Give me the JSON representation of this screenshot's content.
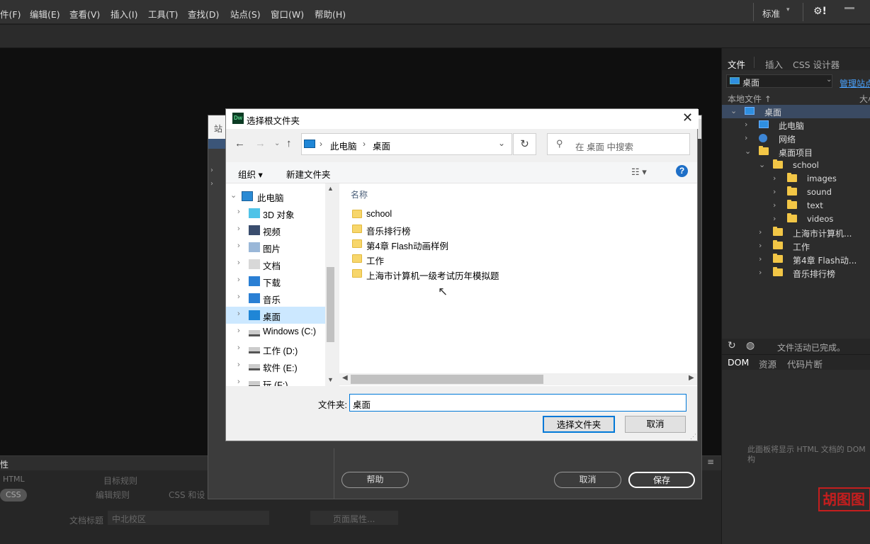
{
  "menubar": {
    "items": [
      "件(F)",
      "编辑(E)",
      "查看(V)",
      "插入(I)",
      "工具(T)",
      "查找(D)",
      "站点(S)",
      "窗口(W)",
      "帮助(H)"
    ],
    "workspace": "标准",
    "gear": "⚙!"
  },
  "right_panel": {
    "tabs": [
      "文件",
      "插入",
      "CSS 设计器"
    ],
    "location": "桌面",
    "manage_link": "管理站点",
    "col_local": "本地文件 ↑",
    "col_size": "大小",
    "tree": [
      {
        "label": "桌面",
        "icon": "desktop",
        "indent": 0,
        "chevron": "⌄",
        "selected": true
      },
      {
        "label": "此电脑",
        "icon": "computer",
        "indent": 1,
        "chevron": "›"
      },
      {
        "label": "网络",
        "icon": "network",
        "indent": 1,
        "chevron": "›"
      },
      {
        "label": "桌面项目",
        "icon": "folder",
        "indent": 1,
        "chevron": "⌄"
      },
      {
        "label": "school",
        "icon": "folder",
        "indent": 2,
        "chevron": "⌄"
      },
      {
        "label": "images",
        "icon": "folder",
        "indent": 3,
        "chevron": "›"
      },
      {
        "label": "sound",
        "icon": "folder",
        "indent": 3,
        "chevron": "›"
      },
      {
        "label": "text",
        "icon": "folder",
        "indent": 3,
        "chevron": "›"
      },
      {
        "label": "videos",
        "icon": "folder",
        "indent": 3,
        "chevron": "›"
      },
      {
        "label": "上海市计算机...",
        "icon": "folder",
        "indent": 2,
        "chevron": "›"
      },
      {
        "label": "工作",
        "icon": "folder",
        "indent": 2,
        "chevron": "›"
      },
      {
        "label": "第4章 Flash动...",
        "icon": "folder",
        "indent": 2,
        "chevron": "›"
      },
      {
        "label": "音乐排行榜",
        "icon": "folder",
        "indent": 2,
        "chevron": "›"
      }
    ],
    "status": "文件活动已完成。",
    "bottom_tabs": [
      "DOM",
      "资源",
      "代码片断"
    ],
    "dom_msg": "此面板将显示 HTML 文档的 DOM 构"
  },
  "bottom_panel": {
    "title": "性",
    "html_label": "HTML",
    "css_label": "CSS",
    "target_rule": "目标规则",
    "edit_rule": "编辑规则",
    "css_designer": "CSS 和设",
    "doc_title_label": "文档标题",
    "doc_title_value": "中北校区",
    "page_props": "页面属性..."
  },
  "site_dialog": {
    "title_partial": "站",
    "help": "帮助",
    "cancel": "取消",
    "save": "保存"
  },
  "file_dialog": {
    "title": "选择根文件夹",
    "app_icon": "Dw",
    "breadcrumb": [
      "此电脑",
      "桌面"
    ],
    "search_placeholder": "在 桌面 中搜索",
    "organize": "组织 ▾",
    "new_folder": "新建文件夹",
    "nav": [
      {
        "label": "此电脑",
        "icon": "computer",
        "top": true
      },
      {
        "label": "3D 对象",
        "icon": "3d"
      },
      {
        "label": "视频",
        "icon": "video"
      },
      {
        "label": "图片",
        "icon": "picture"
      },
      {
        "label": "文档",
        "icon": "document"
      },
      {
        "label": "下载",
        "icon": "download"
      },
      {
        "label": "音乐",
        "icon": "music"
      },
      {
        "label": "桌面",
        "icon": "desktop",
        "selected": true
      },
      {
        "label": "Windows (C:)",
        "icon": "drive"
      },
      {
        "label": "工作 (D:)",
        "icon": "drive"
      },
      {
        "label": "软件 (E:)",
        "icon": "drive"
      },
      {
        "label": "玩 (F:)",
        "icon": "drive"
      }
    ],
    "column_name": "名称",
    "files": [
      "school",
      "音乐排行榜",
      "第4章 Flash动画样例",
      "工作",
      "上海市计算机一级考试历年模拟题"
    ],
    "folder_label": "文件夹:",
    "folder_value": "桌面",
    "select_button": "选择文件夹",
    "cancel_button": "取消"
  },
  "watermark": "胡图图"
}
